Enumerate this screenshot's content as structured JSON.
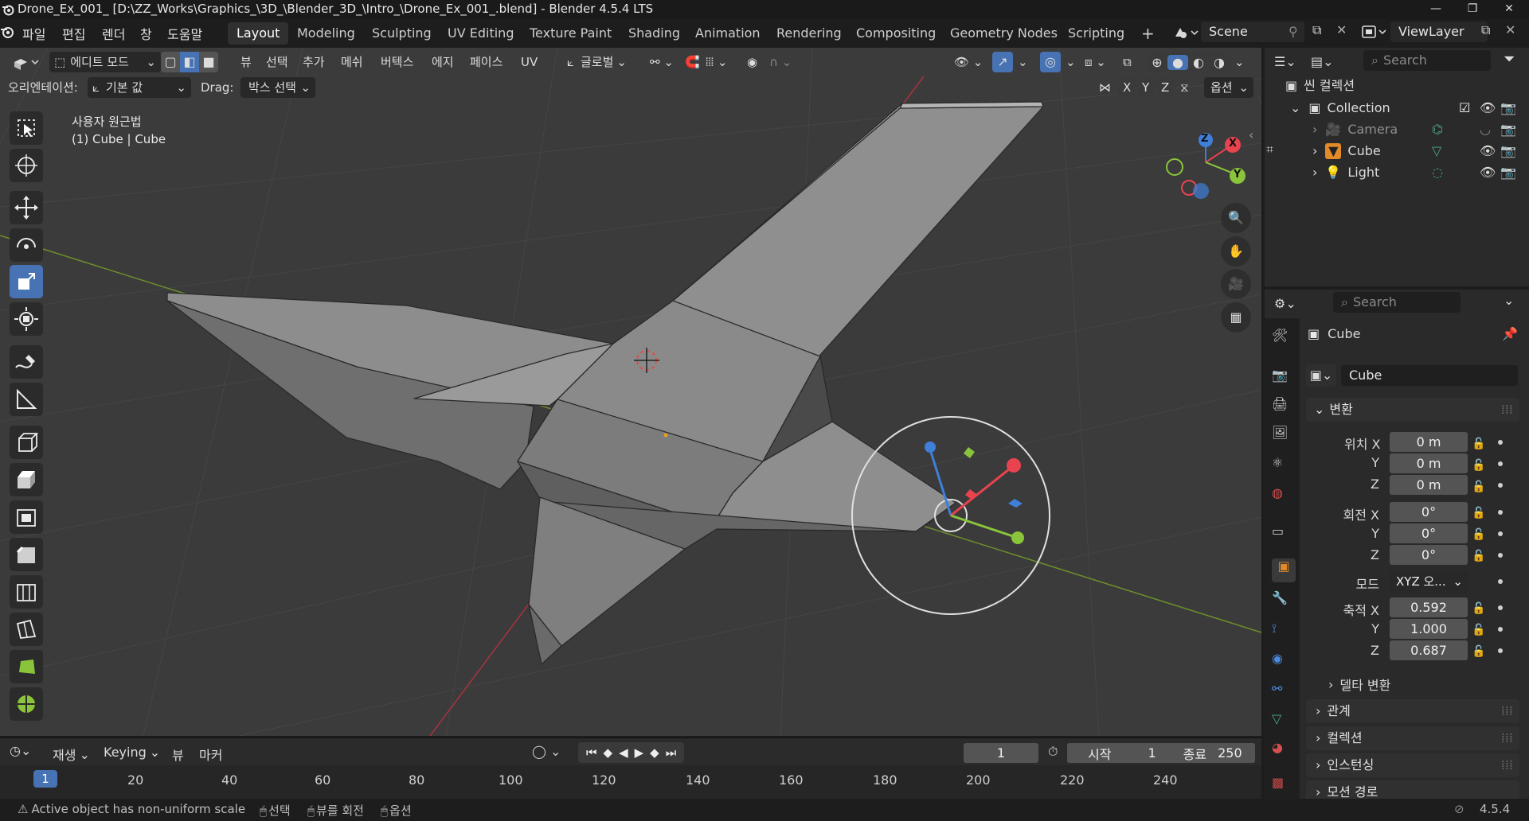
{
  "window": {
    "title": "Drone_Ex_001_ [D:\\ZZ_Works\\Graphics_\\3D_\\Blender_3D_\\Intro_\\Drone_Ex_001_.blend] - Blender 4.5.4 LTS",
    "minimize": "—",
    "maximize": "❐",
    "close": "✕"
  },
  "menubar": {
    "items": [
      "파일",
      "편집",
      "렌더",
      "창",
      "도움말"
    ]
  },
  "workspaces": {
    "tabs": [
      "Layout",
      "Modeling",
      "Sculpting",
      "UV Editing",
      "Texture Paint",
      "Shading",
      "Animation",
      "Rendering",
      "Compositing",
      "Geometry Nodes",
      "Scripting"
    ],
    "active": "Layout",
    "add": "+"
  },
  "scene": {
    "label": "Scene"
  },
  "viewlayer": {
    "label": "ViewLayer"
  },
  "viewport_header": {
    "mode": "에디트 모드",
    "menus": [
      "뷰",
      "선택",
      "추가",
      "메쉬",
      "버텍스",
      "에지",
      "페이스",
      "UV"
    ],
    "transform_orientation": "글로벌",
    "orientation_label": "오리엔테이션:",
    "orientation_value": "기본 값",
    "drag_label": "Drag:",
    "drag_value": "박스 선택",
    "axes": [
      "X",
      "Y",
      "Z"
    ],
    "options": "옵션"
  },
  "viewport_overlay": {
    "view_name": "사용자 원근법",
    "object_info": "(1) Cube | Cube"
  },
  "gizmo_axes": {
    "x": "X",
    "y": "Y",
    "z": "Z"
  },
  "outliner": {
    "search_placeholder": "Search",
    "scene_collection": "씬 컬렉션",
    "collection": "Collection",
    "items": [
      "Camera",
      "Cube",
      "Light"
    ]
  },
  "properties": {
    "search_placeholder": "Search",
    "object_name": "Cube",
    "object_field": "Cube",
    "transform_header": "변환",
    "location_label": "위치 X",
    "rotation_label": "회전 X",
    "mode_label": "모드",
    "scale_label": "축적 X",
    "y_label": "Y",
    "z_label": "Z",
    "location": [
      "0 m",
      "0 m",
      "0 m"
    ],
    "rotation": [
      "0°",
      "0°",
      "0°"
    ],
    "rotation_mode": "XYZ 오...",
    "scale": [
      "0.592",
      "1.000",
      "0.687"
    ],
    "delta_transform": "델타 변환",
    "sections": [
      "관계",
      "컬렉션",
      "인스턴싱",
      "모션 경로"
    ]
  },
  "timeline": {
    "playback": "재생",
    "keying": "Keying",
    "view": "뷰",
    "marker": "마커",
    "current_frame": "1",
    "start_label": "시작",
    "start": "1",
    "end_label": "종료",
    "end": "250",
    "frame_marker": "1",
    "ruler": [
      "20",
      "40",
      "60",
      "80",
      "100",
      "120",
      "140",
      "160",
      "180",
      "200",
      "220",
      "240"
    ]
  },
  "statusbar": {
    "warning": "Active object has non-uniform scale",
    "select": "선택",
    "rotate_view": "뷰를 회전",
    "options": "옵션",
    "version": "4.5.4"
  },
  "colors": {
    "accent": "#4772b3",
    "axis_x": "#e8434f",
    "axis_y": "#8ac43a",
    "axis_z": "#3f7fd8",
    "viewport_bg": "#3b3b3b"
  }
}
